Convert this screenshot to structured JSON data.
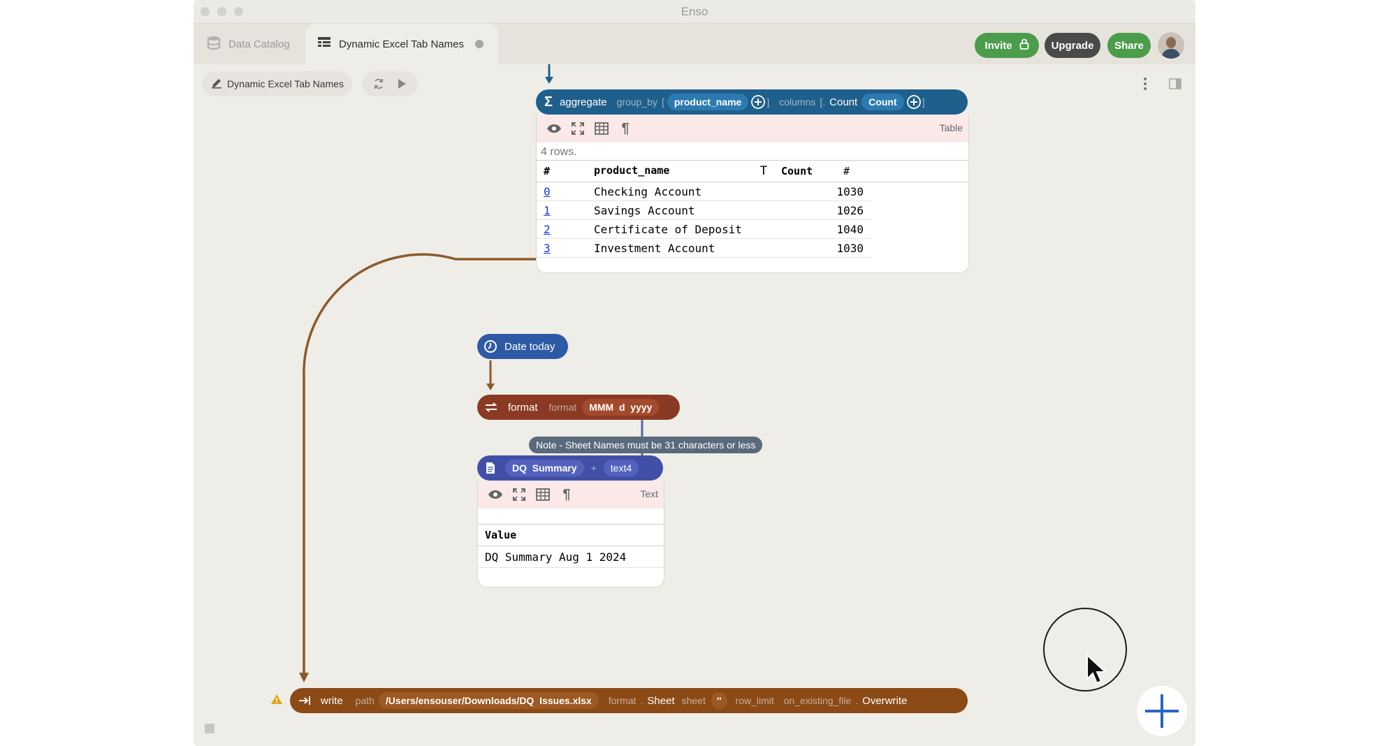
{
  "window": {
    "title": "Enso"
  },
  "tabs": [
    {
      "label": "Data Catalog"
    },
    {
      "label": "Dynamic Excel Tab Names"
    }
  ],
  "header_buttons": {
    "invite": "Invite",
    "upgrade": "Upgrade",
    "share": "Share"
  },
  "project": {
    "name": "Dynamic Excel Tab Names"
  },
  "aggregate_node": {
    "method": "aggregate",
    "arg1_name": "group_by",
    "arg1_open": "[",
    "arg1_value": "product_name",
    "arg1_close": "]",
    "arg2_name": "columns",
    "arg2_open": "[",
    "arg2_dot": ".",
    "arg2_value1": "Count",
    "arg2_value2": "Count",
    "arg2_close": "]",
    "viz_type": "Table",
    "row_count": "4 rows.",
    "columns": [
      "#",
      "product_name",
      "Count"
    ],
    "rows": [
      {
        "index": "0",
        "product_name": "Checking Account",
        "count": "1030"
      },
      {
        "index": "1",
        "product_name": "Savings Account",
        "count": "1026"
      },
      {
        "index": "2",
        "product_name": "Certificate of Deposit",
        "count": "1040"
      },
      {
        "index": "3",
        "product_name": "Investment Account",
        "count": "1030"
      }
    ]
  },
  "date_node": {
    "label": "Date",
    "method": "today"
  },
  "format_node": {
    "method": "format",
    "arg_name": "format",
    "arg_value": "MMM  d  yyyy"
  },
  "comment": {
    "text": "Note - Sheet Names must be 31 characters or less"
  },
  "text_node": {
    "literal": "DQ  Summary",
    "operator": "+",
    "operand": "text4",
    "viz_type": "Text",
    "column_header": "Value",
    "value": "DQ Summary Aug 1 2024"
  },
  "write_node": {
    "method": "write",
    "path_label": "path",
    "path_value": "/Users/ensouser/Downloads/DQ  Issues.xlsx",
    "format_label": "format",
    "format_dot": ".",
    "format_value": "Sheet",
    "sheet_label": "sheet",
    "sheet_value": "''",
    "row_limit_label": "row_limit",
    "on_existing_label": "on_existing_file",
    "on_existing_dot": ".",
    "on_existing_value": "Overwrite"
  },
  "colors": {
    "aggregate": "#1f5f8b",
    "date": "#2e5aa5",
    "format": "#8a3a22",
    "text": "#4150a6",
    "write": "#8b4a16",
    "edge": "#8b5a2b",
    "invite": "#4b9c4b",
    "share": "#4b9c4b",
    "upgrade": "#4a4a4a"
  },
  "icons": [
    "database-icon",
    "table-icon",
    "pencil-icon",
    "refresh-icon",
    "play-icon",
    "lock-icon",
    "sigma-icon",
    "clock-icon",
    "swap-icon",
    "document-icon",
    "write-icon",
    "eye-icon",
    "expand-icon",
    "grid-icon",
    "pilcrow-icon",
    "warning-icon",
    "plus-icon",
    "cursor-icon",
    "more-icon",
    "panel-icon"
  ]
}
